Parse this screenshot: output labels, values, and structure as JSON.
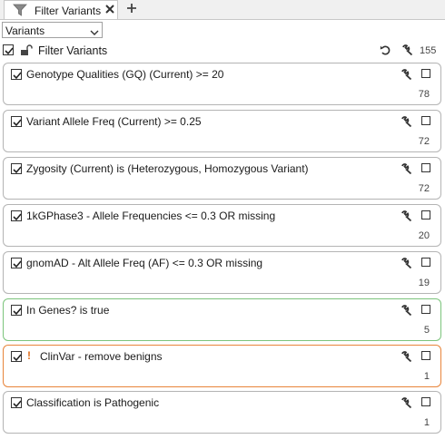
{
  "tab": {
    "label": "Filter Variants"
  },
  "dropdown": {
    "value": "Variants"
  },
  "header": {
    "title": "Filter Variants",
    "count": "155"
  },
  "colors": {
    "green_border": "#7cc47c",
    "orange_border": "#e8843a",
    "warning": "#e07020"
  },
  "cards": [
    {
      "title": "Genotype Qualities (GQ) (Current) >= 20",
      "count": "78",
      "checked": true
    },
    {
      "title": "Variant Allele Freq (Current) >= 0.25",
      "count": "72",
      "checked": true
    },
    {
      "title": "Zygosity (Current) is (Heterozygous, Homozygous Variant)",
      "count": "72",
      "checked": true
    },
    {
      "title": "1kGPhase3 - Allele Frequencies <= 0.3 OR missing",
      "count": "20",
      "checked": true
    },
    {
      "title": "gnomAD - Alt Allele Freq (AF) <= 0.3 OR missing",
      "count": "19",
      "checked": true
    },
    {
      "title": "In Genes? is true",
      "count": "5",
      "checked": true
    },
    {
      "title": "ClinVar - remove benigns",
      "warning": "!",
      "count": "1",
      "checked": true
    },
    {
      "title": "Classification is Pathogenic",
      "count": "1",
      "checked": true
    }
  ]
}
